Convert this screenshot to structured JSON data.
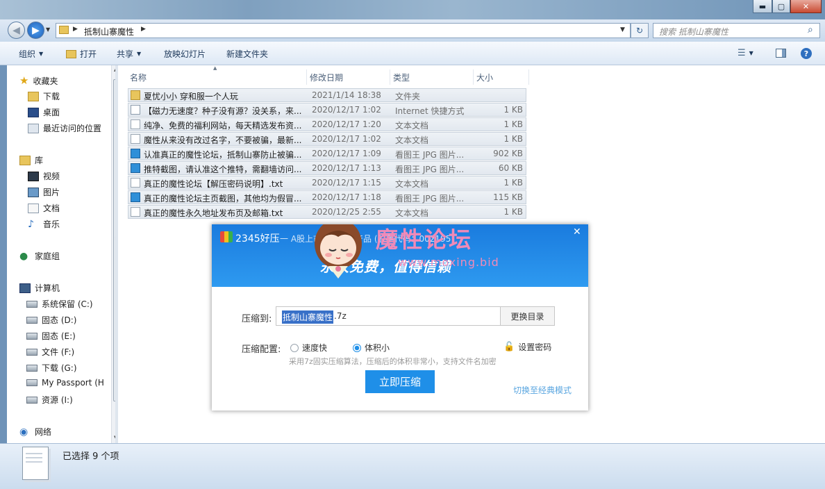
{
  "window": {
    "minimize": "▬",
    "maximize": "▢",
    "close": "✕"
  },
  "address": {
    "path": "抵制山寨魔性",
    "search_placeholder": "搜索 抵制山寨魔性"
  },
  "toolbar": {
    "organize": "组织",
    "open": "打开",
    "share": "共享",
    "slideshow": "放映幻灯片",
    "new_folder": "新建文件夹"
  },
  "nav": {
    "favorites": "收藏夹",
    "downloads": "下载",
    "desktop": "桌面",
    "recent": "最近访问的位置",
    "libraries": "库",
    "videos": "视频",
    "pictures": "图片",
    "documents": "文档",
    "music": "音乐",
    "homegroup": "家庭组",
    "computer": "计算机",
    "drives": [
      {
        "label": "系统保留 (C:)"
      },
      {
        "label": "固态 (D:)"
      },
      {
        "label": "固态 (E:)"
      },
      {
        "label": "文件 (F:)"
      },
      {
        "label": "下载 (G:)"
      },
      {
        "label": "My Passport (H"
      },
      {
        "label": "资源 (I:)"
      }
    ],
    "network": "网络"
  },
  "columns": {
    "name": "名称",
    "date": "修改日期",
    "type": "类型",
    "size": "大小"
  },
  "files": [
    {
      "name": "夏忧小小 穿和服一个人玩",
      "date": "2021/1/14 18:38",
      "type": "文件夹",
      "size": "",
      "icon": "folder"
    },
    {
      "name": "【磁力无速度？种子没有源？没关系，来...",
      "date": "2020/12/17 1:02",
      "type": "Internet 快捷方式",
      "size": "1 KB",
      "icon": "shortcut"
    },
    {
      "name": "纯净、免费的福利网站，每天精选发布资...",
      "date": "2020/12/17 1:20",
      "type": "文本文档",
      "size": "1 KB",
      "icon": "txt"
    },
    {
      "name": "魔性从来没有改过名字，不要被骗，最新...",
      "date": "2020/12/17 1:02",
      "type": "文本文档",
      "size": "1 KB",
      "icon": "txt"
    },
    {
      "name": "认准真正的魔性论坛，抵制山寨防止被骗...",
      "date": "2020/12/17 1:09",
      "type": "看图王 JPG 图片...",
      "size": "902 KB",
      "icon": "jpg"
    },
    {
      "name": "推特截图，请认准这个推特，需翻墙访问...",
      "date": "2020/12/17 1:13",
      "type": "看图王 JPG 图片...",
      "size": "60 KB",
      "icon": "jpg"
    },
    {
      "name": "真正的魔性论坛【解压密码说明】.txt",
      "date": "2020/12/17 1:15",
      "type": "文本文档",
      "size": "1 KB",
      "icon": "txt"
    },
    {
      "name": "真正的魔性论坛主页截图，其他均为假冒...",
      "date": "2020/12/17 1:18",
      "type": "看图王 JPG 图片...",
      "size": "115 KB",
      "icon": "jpg"
    },
    {
      "name": "真正的魔性永久地址发布页及邮箱.txt",
      "date": "2020/12/25 2:55",
      "type": "文本文档",
      "size": "1 KB",
      "icon": "txt"
    }
  ],
  "status": {
    "selection": "已选择 9 个项"
  },
  "dialog": {
    "app_name": "2345好压",
    "tagline_small": "一 A股上市公司旗下产品 (股票代码：002195)",
    "slogan": "永久免费，值得信赖",
    "watermark_title": "魔性论坛",
    "watermark_url": "www.moxing.bid",
    "compress_to_label": "压缩到:",
    "path_selected": "抵制山寨魔性",
    "path_ext": ".7z",
    "change_dir": "更换目录",
    "config_label": "压缩配置:",
    "option_fast": "速度快",
    "option_small": "体积小",
    "selected_option": "体积小",
    "set_password": "设置密码",
    "hint": "采用7z固实压缩算法，压缩后的体积非常小，支持文件名加密",
    "compress_button": "立即压缩",
    "classic_mode": "切换至经典模式",
    "close": "✕"
  }
}
